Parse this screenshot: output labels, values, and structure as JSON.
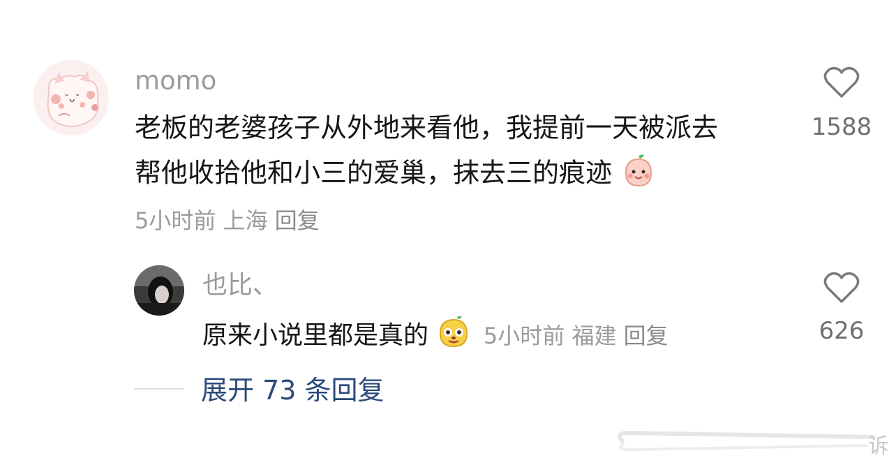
{
  "comment": {
    "username": "momo",
    "text_line1": "老板的老婆孩子从外地来看他，我提前一天被派去",
    "text_line2": "帮他收拾他和小三的爱巢，抹去三的痕迹",
    "time": "5小时前",
    "location": "上海",
    "reply_label": "回复",
    "like_count": "1588",
    "emoji_icon": "smiling-peach-emoji-icon"
  },
  "reply": {
    "username": "也比、",
    "text": "原来小说里都是真的",
    "time": "5小时前",
    "location": "福建",
    "reply_label": "回复",
    "like_count": "626",
    "emoji_icon": "yellow-dog-emoji-icon"
  },
  "expand_replies": {
    "label": "展开 73 条回复"
  },
  "watermark": {
    "text": "诉"
  },
  "colors": {
    "accent_link": "#2a4a7a",
    "muted_text": "#9b9b9b",
    "body_text": "#161616"
  }
}
